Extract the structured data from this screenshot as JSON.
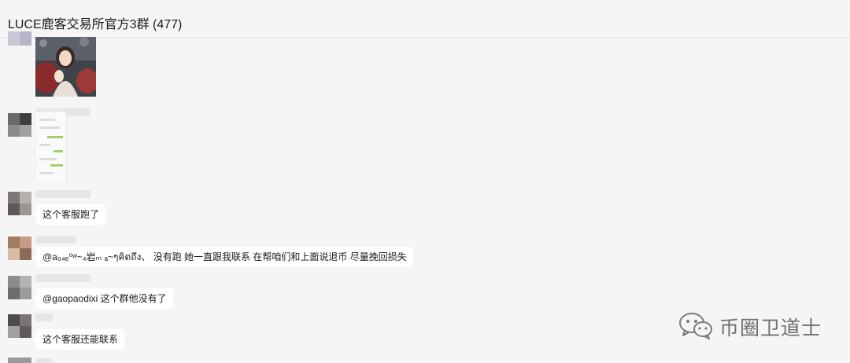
{
  "window": {
    "title": "LUCE鹿客交易所官方3群 (477)"
  },
  "messages": [
    {
      "type": "image",
      "content": "photo"
    },
    {
      "type": "image",
      "content": "chat-screenshot"
    },
    {
      "type": "text",
      "text": "这个客服跑了"
    },
    {
      "type": "text",
      "text": "@a₀₄ₑ⁰ʷ~₄岩ₘ ₐ~ๆคิดถึง、 没有跑 她一直跟我联系 在帮咱们和上面说退币 尽量挽回损失"
    },
    {
      "type": "text",
      "text": "@gaopaodixi 这个群他没有了"
    },
    {
      "type": "text",
      "text": "这个客服还能联系"
    }
  ],
  "watermark": {
    "text": "币圈卫道士",
    "icon": "wechat-icon"
  }
}
